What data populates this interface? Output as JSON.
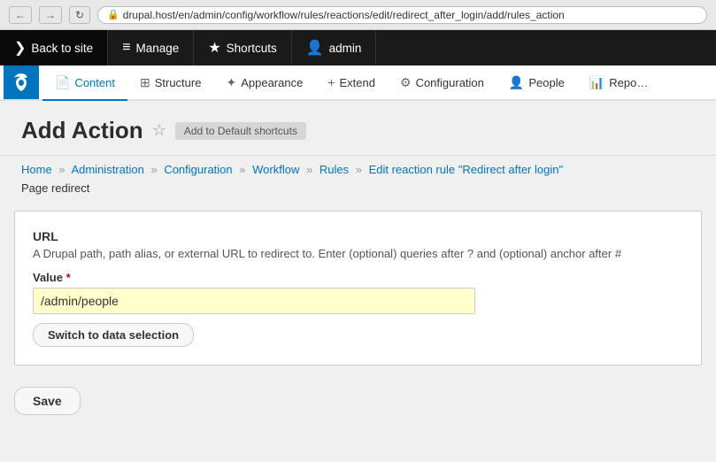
{
  "browser": {
    "url": "drupal.host/en/admin/config/workflow/rules/reactions/edit/redirect_after_login/add/rules_action",
    "back_label": "←",
    "forward_label": "→",
    "refresh_label": "↻"
  },
  "toolbar": {
    "back_to_site": "Back to site",
    "manage": "Manage",
    "shortcuts": "Shortcuts",
    "admin": "admin"
  },
  "secondary_nav": {
    "items": [
      {
        "id": "content",
        "label": "Content",
        "icon": "📄",
        "active": true
      },
      {
        "id": "structure",
        "label": "Structure",
        "icon": "⊞"
      },
      {
        "id": "appearance",
        "label": "Appearance",
        "icon": "✦"
      },
      {
        "id": "extend",
        "label": "Extend",
        "icon": "+"
      },
      {
        "id": "configuration",
        "label": "Configuration",
        "icon": "⚙"
      },
      {
        "id": "people",
        "label": "People",
        "icon": "👤"
      },
      {
        "id": "reports",
        "label": "Repo…",
        "icon": "📊"
      }
    ]
  },
  "page": {
    "title": "Add Action",
    "shortcut_btn": "Add to Default shortcuts",
    "breadcrumb": [
      {
        "label": "Home",
        "href": "#"
      },
      {
        "label": "Administration",
        "href": "#"
      },
      {
        "label": "Configuration",
        "href": "#"
      },
      {
        "label": "Workflow",
        "href": "#"
      },
      {
        "label": "Rules",
        "href": "#"
      },
      {
        "label": "Edit reaction rule \"Redirect after login\"",
        "href": "#"
      }
    ],
    "sub_label": "Page redirect"
  },
  "form": {
    "url_label": "URL",
    "url_description": "A Drupal path, path alias, or external URL to redirect to. Enter (optional) queries after ? and (optional) anchor after #",
    "value_label": "Value",
    "required": true,
    "value": "/admin/people",
    "switch_btn": "Switch to data selection"
  },
  "actions": {
    "save_label": "Save"
  }
}
